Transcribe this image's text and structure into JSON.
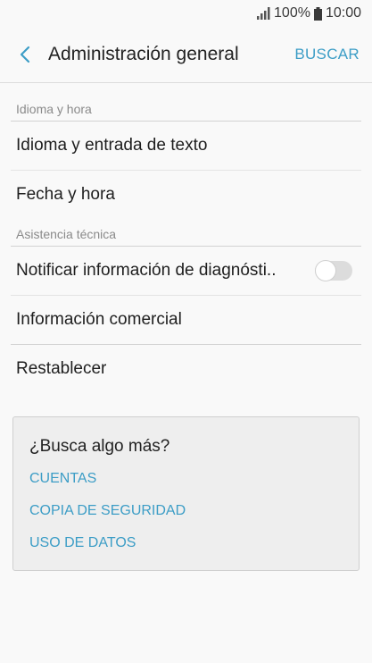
{
  "status_bar": {
    "battery": "100%",
    "time": "10:00"
  },
  "header": {
    "title": "Administración general",
    "search_label": "BUSCAR"
  },
  "sections": [
    {
      "title": "Idioma y hora",
      "items": [
        {
          "label": "Idioma y entrada de texto"
        },
        {
          "label": "Fecha y hora"
        }
      ]
    },
    {
      "title": "Asistencia técnica",
      "items": [
        {
          "label": "Notificar información de diagnósti..",
          "toggle": false
        },
        {
          "label": "Información comercial"
        },
        {
          "label": "Restablecer"
        }
      ]
    }
  ],
  "more_card": {
    "title": "¿Busca algo más?",
    "links": [
      "CUENTAS",
      "COPIA DE SEGURIDAD",
      "USO DE DATOS"
    ]
  },
  "colors": {
    "accent": "#3c9dc6",
    "background": "#f9f9f9",
    "card_background": "#eeeeee"
  }
}
